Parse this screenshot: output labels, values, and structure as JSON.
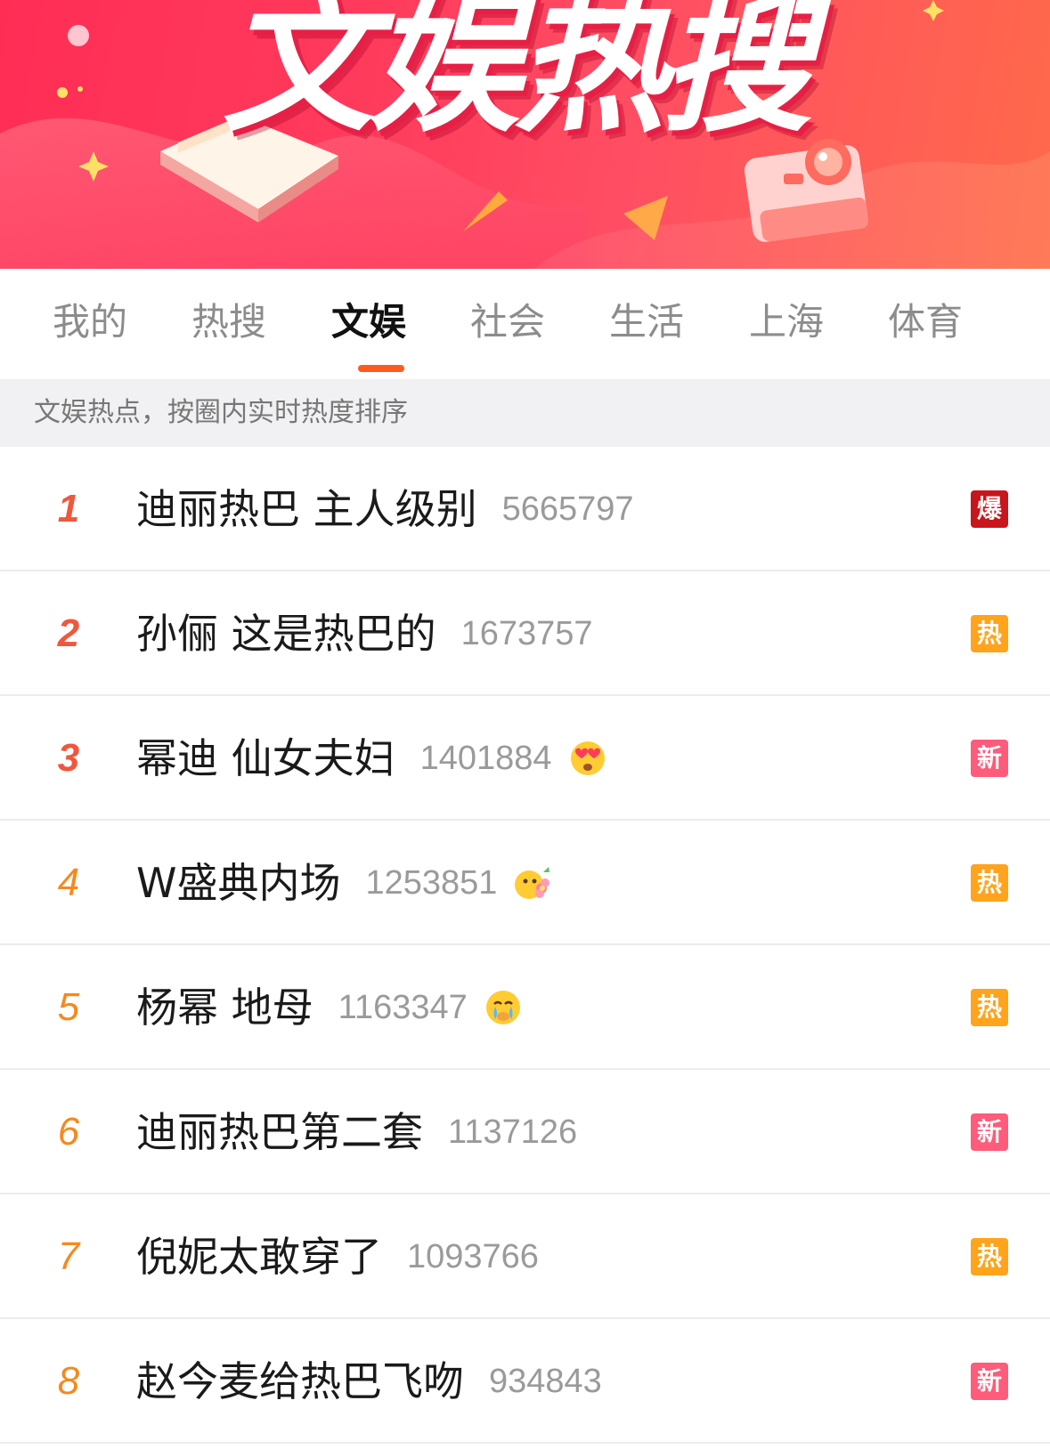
{
  "banner": {
    "title": "文娱热搜"
  },
  "tabs": [
    {
      "label": "我的",
      "active": false
    },
    {
      "label": "热搜",
      "active": false
    },
    {
      "label": "文娱",
      "active": true
    },
    {
      "label": "社会",
      "active": false
    },
    {
      "label": "生活",
      "active": false
    },
    {
      "label": "上海",
      "active": false
    },
    {
      "label": "体育",
      "active": false
    }
  ],
  "subheader": {
    "text": "文娱热点，按圈内实时热度排序"
  },
  "colors": {
    "accent": "#ff5a1f",
    "rank_top": "#f0573c",
    "rank_rest": "#f5891f",
    "badge_bao": "#c8161d",
    "badge_re": "#ffa41c",
    "badge_xin": "#ff5b7a"
  },
  "list": [
    {
      "rank": "1",
      "title": "迪丽热巴 主人级别",
      "count": "5665797",
      "emoji": "",
      "badge": "爆",
      "badge_type": "bao"
    },
    {
      "rank": "2",
      "title": "孙俪 这是热巴的",
      "count": "1673757",
      "emoji": "",
      "badge": "热",
      "badge_type": "re"
    },
    {
      "rank": "3",
      "title": "幂迪 仙女夫妇",
      "count": "1401884",
      "emoji": "heart-eyes-emoji",
      "badge": "新",
      "badge_type": "xin"
    },
    {
      "rank": "4",
      "title": "W盛典内场",
      "count": "1253851",
      "emoji": "flower-emoji",
      "badge": "热",
      "badge_type": "re"
    },
    {
      "rank": "5",
      "title": "杨幂 地母",
      "count": "1163347",
      "emoji": "crying-emoji",
      "badge": "热",
      "badge_type": "re"
    },
    {
      "rank": "6",
      "title": "迪丽热巴第二套",
      "count": "1137126",
      "emoji": "",
      "badge": "新",
      "badge_type": "xin"
    },
    {
      "rank": "7",
      "title": "倪妮太敢穿了",
      "count": "1093766",
      "emoji": "",
      "badge": "热",
      "badge_type": "re"
    },
    {
      "rank": "8",
      "title": "赵今麦给热巴飞吻",
      "count": "934843",
      "emoji": "",
      "badge": "新",
      "badge_type": "xin"
    }
  ]
}
